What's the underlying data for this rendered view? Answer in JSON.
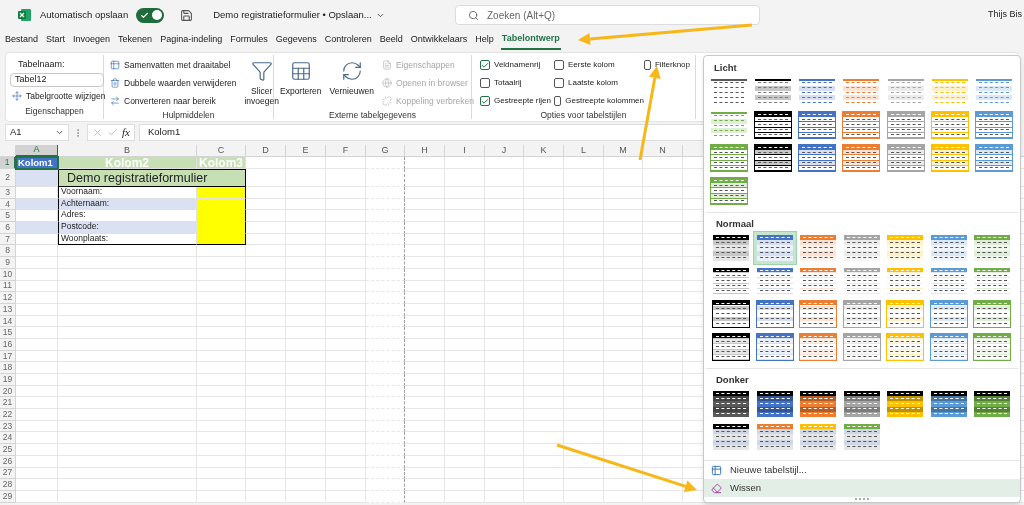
{
  "title_bar": {
    "autosave": {
      "label": "Automatisch opslaan",
      "on": true
    },
    "document_title": "Demo registratieformulier • Opslaan...",
    "search": {
      "placeholder": "Zoeken (Alt+Q)"
    },
    "user": "Thijs Bis"
  },
  "menu_tabs": [
    {
      "label": "Bestand",
      "selected": false
    },
    {
      "label": "Start",
      "selected": false
    },
    {
      "label": "Invoegen",
      "selected": false
    },
    {
      "label": "Tekenen",
      "selected": false
    },
    {
      "label": "Pagina-indeling",
      "selected": false
    },
    {
      "label": "Formules",
      "selected": false
    },
    {
      "label": "Gegevens",
      "selected": false
    },
    {
      "label": "Controleren",
      "selected": false
    },
    {
      "label": "Beeld",
      "selected": false
    },
    {
      "label": "Ontwikkelaars",
      "selected": false
    },
    {
      "label": "Help",
      "selected": false
    },
    {
      "label": "Tabelontwerp",
      "selected": true
    }
  ],
  "ribbon": {
    "groups": [
      {
        "label": "Eigenschappen",
        "items": [
          {
            "kind": "label",
            "text": "Tabelnaam:"
          },
          {
            "kind": "field",
            "value": "Tabel12"
          },
          {
            "kind": "small",
            "text": "Tabelgrootte wijzigen",
            "disabled": false
          }
        ]
      },
      {
        "label": "Hulpmiddelen",
        "items": [
          {
            "kind": "small",
            "text": "Samenvatten met draaitabel",
            "disabled": false
          },
          {
            "kind": "small",
            "text": "Dubbele waarden verwijderen",
            "disabled": false
          },
          {
            "kind": "small",
            "text": "Converteren naar bereik",
            "disabled": false
          },
          {
            "kind": "large",
            "text": "Slicer invoegen",
            "disabled": false
          }
        ]
      },
      {
        "label": "Externe tabelgegevens",
        "items": [
          {
            "kind": "large",
            "text": "Exporteren",
            "disabled": false
          },
          {
            "kind": "large",
            "text": "Vernieuwen",
            "disabled": false
          },
          {
            "kind": "small",
            "text": "Eigenschappen",
            "disabled": true
          },
          {
            "kind": "small",
            "text": "Openen in browser",
            "disabled": true
          },
          {
            "kind": "small",
            "text": "Koppeling verbreken",
            "disabled": true
          }
        ]
      },
      {
        "label": "Opties voor tabelstijlen",
        "items": [
          {
            "kind": "checkbox",
            "text": "Veldnamenrij",
            "checked": true
          },
          {
            "kind": "checkbox",
            "text": "Totaalrij",
            "checked": false
          },
          {
            "kind": "checkbox",
            "text": "Gestreepte rijen",
            "checked": true
          },
          {
            "kind": "checkbox",
            "text": "Eerste kolom",
            "checked": false
          },
          {
            "kind": "checkbox",
            "text": "Laatste kolom",
            "checked": false
          },
          {
            "kind": "checkbox",
            "text": "Gestreepte kolommen",
            "checked": false
          },
          {
            "kind": "checkbox",
            "text": "Filterknop",
            "checked": false
          }
        ]
      }
    ]
  },
  "formula_bar": {
    "name_box": "A1",
    "function_label": "fx",
    "formula": "Kolom1"
  },
  "sheet": {
    "columns": [
      {
        "label": "A",
        "selected": true
      },
      {
        "label": "B",
        "selected": false
      },
      {
        "label": "C",
        "selected": false
      },
      {
        "label": "D",
        "selected": false
      },
      {
        "label": "E",
        "selected": false
      },
      {
        "label": "F",
        "selected": false
      },
      {
        "label": "G",
        "selected": false
      },
      {
        "label": "H",
        "selected": false
      },
      {
        "label": "I",
        "selected": false
      },
      {
        "label": "J",
        "selected": false
      },
      {
        "label": "K",
        "selected": false
      },
      {
        "label": "L",
        "selected": false
      },
      {
        "label": "M",
        "selected": false
      },
      {
        "label": "N",
        "selected": false
      }
    ],
    "rows": [
      {
        "number": "1",
        "selected": true,
        "cells": [
          {
            "kind": "header",
            "text": "Kolom1",
            "selected": true
          },
          {
            "kind": "header",
            "text": "Kolom2",
            "selected": false
          },
          {
            "kind": "header",
            "text": "Kolom3",
            "selected": false
          }
        ]
      },
      {
        "number": "2",
        "selected": false,
        "cells": [
          {
            "kind": "empty",
            "selected": false,
            "banded": true
          },
          {
            "kind": "title",
            "text": "Demo registratieformulier",
            "selected": false
          }
        ]
      },
      {
        "number": "3",
        "selected": false,
        "cells": [
          {
            "kind": "empty",
            "selected": false,
            "banded": false
          },
          {
            "kind": "label",
            "text": "Voornaam:",
            "selected": false,
            "banded": false
          },
          {
            "kind": "input",
            "selected": false
          }
        ]
      },
      {
        "number": "4",
        "selected": false,
        "cells": [
          {
            "kind": "empty",
            "selected": false,
            "banded": true
          },
          {
            "kind": "label",
            "text": "Achternaam:",
            "selected": false,
            "banded": true
          },
          {
            "kind": "input",
            "selected": false
          }
        ]
      },
      {
        "number": "5",
        "selected": false,
        "cells": [
          {
            "kind": "empty",
            "selected": false,
            "banded": false
          },
          {
            "kind": "label",
            "text": "Adres:",
            "selected": false,
            "banded": false
          },
          {
            "kind": "input",
            "selected": false
          }
        ]
      },
      {
        "number": "6",
        "selected": false,
        "cells": [
          {
            "kind": "empty",
            "selected": false,
            "banded": true
          },
          {
            "kind": "label",
            "text": "Postcode:",
            "selected": false,
            "banded": true
          },
          {
            "kind": "input",
            "selected": false
          }
        ]
      },
      {
        "number": "7",
        "selected": false,
        "cells": [
          {
            "kind": "empty",
            "selected": false,
            "banded": false
          },
          {
            "kind": "label",
            "text": "Woonplaats:",
            "selected": false,
            "banded": false
          },
          {
            "kind": "input",
            "selected": false
          }
        ]
      },
      {
        "number": "8",
        "selected": false
      },
      {
        "number": "9",
        "selected": false
      },
      {
        "number": "10",
        "selected": false
      },
      {
        "number": "11",
        "selected": false
      },
      {
        "number": "12",
        "selected": false
      },
      {
        "number": "13",
        "selected": false
      },
      {
        "number": "14",
        "selected": false
      },
      {
        "number": "15",
        "selected": false
      },
      {
        "number": "16",
        "selected": false
      },
      {
        "number": "17",
        "selected": false
      },
      {
        "number": "18",
        "selected": false
      },
      {
        "number": "19",
        "selected": false
      },
      {
        "number": "20",
        "selected": false
      },
      {
        "number": "21",
        "selected": false
      },
      {
        "number": "22",
        "selected": false
      },
      {
        "number": "23",
        "selected": false
      },
      {
        "number": "24",
        "selected": false
      },
      {
        "number": "25",
        "selected": false
      },
      {
        "number": "26",
        "selected": false
      },
      {
        "number": "27",
        "selected": false
      },
      {
        "number": "28",
        "selected": false
      },
      {
        "number": "29",
        "selected": false
      }
    ]
  },
  "gallery": {
    "sections": [
      {
        "title": "Licht",
        "styles": [
          {
            "kind": "plain",
            "color": "#595959",
            "selected": false
          },
          {
            "kind": "banded",
            "color": "#000000",
            "selected": false
          },
          {
            "kind": "banded",
            "color": "#4472c4",
            "selected": false
          },
          {
            "kind": "banded",
            "color": "#ed7d31",
            "selected": false
          },
          {
            "kind": "banded",
            "color": "#a5a5a5",
            "selected": false
          },
          {
            "kind": "banded",
            "color": "#ffc000",
            "selected": false
          },
          {
            "kind": "banded",
            "color": "#5b9bd5",
            "selected": false
          },
          {
            "kind": "banded",
            "color": "#70ad47",
            "selected": false
          },
          {
            "kind": "header",
            "color": "#000000",
            "selected": false
          },
          {
            "kind": "header",
            "color": "#4472c4",
            "selected": false
          },
          {
            "kind": "header",
            "color": "#ed7d31",
            "selected": false
          },
          {
            "kind": "header",
            "color": "#a5a5a5",
            "selected": false
          },
          {
            "kind": "header",
            "color": "#ffc000",
            "selected": false
          },
          {
            "kind": "header",
            "color": "#5b9bd5",
            "selected": false
          },
          {
            "kind": "header",
            "color": "#70ad47",
            "selected": false
          },
          {
            "kind": "grid",
            "color": "#000000",
            "selected": false
          },
          {
            "kind": "grid",
            "color": "#4472c4",
            "selected": false
          },
          {
            "kind": "grid",
            "color": "#ed7d31",
            "selected": false
          },
          {
            "kind": "grid",
            "color": "#a5a5a5",
            "selected": false
          },
          {
            "kind": "grid",
            "color": "#ffc000",
            "selected": false
          },
          {
            "kind": "grid",
            "color": "#5b9bd5",
            "selected": false
          },
          {
            "kind": "grid",
            "color": "#70ad47",
            "selected": false
          }
        ]
      },
      {
        "title": "Normaal",
        "styles": [
          {
            "kind": "striped",
            "color": "#000000",
            "selected": false
          },
          {
            "kind": "striped",
            "color": "#4472c4",
            "selected": true
          },
          {
            "kind": "striped",
            "color": "#ed7d31",
            "selected": false
          },
          {
            "kind": "striped",
            "color": "#a5a5a5",
            "selected": false
          },
          {
            "kind": "striped",
            "color": "#ffc000",
            "selected": false
          },
          {
            "kind": "striped",
            "color": "#5b9bd5",
            "selected": false
          },
          {
            "kind": "striped",
            "color": "#70ad47",
            "selected": false
          },
          {
            "kind": "lined",
            "color": "#000000",
            "selected": false
          },
          {
            "kind": "lined",
            "color": "#4472c4",
            "selected": false
          },
          {
            "kind": "lined",
            "color": "#ed7d31",
            "selected": false
          },
          {
            "kind": "lined",
            "color": "#a5a5a5",
            "selected": false
          },
          {
            "kind": "lined",
            "color": "#ffc000",
            "selected": false
          },
          {
            "kind": "lined",
            "color": "#5b9bd5",
            "selected": false
          },
          {
            "kind": "lined",
            "color": "#70ad47",
            "selected": false
          },
          {
            "kind": "boxed",
            "color": "#000000",
            "selected": false
          },
          {
            "kind": "boxed",
            "color": "#4472c4",
            "selected": false
          },
          {
            "kind": "boxed",
            "color": "#ed7d31",
            "selected": false
          },
          {
            "kind": "boxed",
            "color": "#a5a5a5",
            "selected": false
          },
          {
            "kind": "boxed",
            "color": "#ffc000",
            "selected": false
          },
          {
            "kind": "boxed",
            "color": "#5b9bd5",
            "selected": false
          },
          {
            "kind": "boxed",
            "color": "#70ad47",
            "selected": false
          },
          {
            "kind": "framed",
            "color": "#000000",
            "selected": false
          },
          {
            "kind": "framed",
            "color": "#4472c4",
            "selected": false
          },
          {
            "kind": "framed",
            "color": "#ed7d31",
            "selected": false
          },
          {
            "kind": "framed",
            "color": "#a5a5a5",
            "selected": false
          },
          {
            "kind": "framed",
            "color": "#ffc000",
            "selected": false
          },
          {
            "kind": "framed",
            "color": "#5b9bd5",
            "selected": false
          },
          {
            "kind": "framed",
            "color": "#70ad47",
            "selected": false
          }
        ]
      },
      {
        "title": "Donker",
        "styles": [
          {
            "kind": "dark",
            "color": "#595959",
            "selected": false
          },
          {
            "kind": "dark",
            "color": "#4472c4",
            "selected": false
          },
          {
            "kind": "dark",
            "color": "#ed7d31",
            "selected": false
          },
          {
            "kind": "dark",
            "color": "#a5a5a5",
            "selected": false
          },
          {
            "kind": "dark",
            "color": "#ffc000",
            "selected": false
          },
          {
            "kind": "dark",
            "color": "#5b9bd5",
            "selected": false
          },
          {
            "kind": "dark",
            "color": "#70ad47",
            "selected": false
          },
          {
            "kind": "contrast",
            "color": "#000000",
            "selected": false
          },
          {
            "kind": "contrast",
            "color": "#ed7d31",
            "selected": false
          },
          {
            "kind": "contrast",
            "color": "#ffc000",
            "selected": false
          },
          {
            "kind": "contrast",
            "color": "#70ad47",
            "selected": false
          }
        ]
      }
    ],
    "menu": [
      {
        "label": "Nieuwe tabelstijl...",
        "selected": false
      },
      {
        "label": "Wissen",
        "selected": true
      }
    ]
  }
}
